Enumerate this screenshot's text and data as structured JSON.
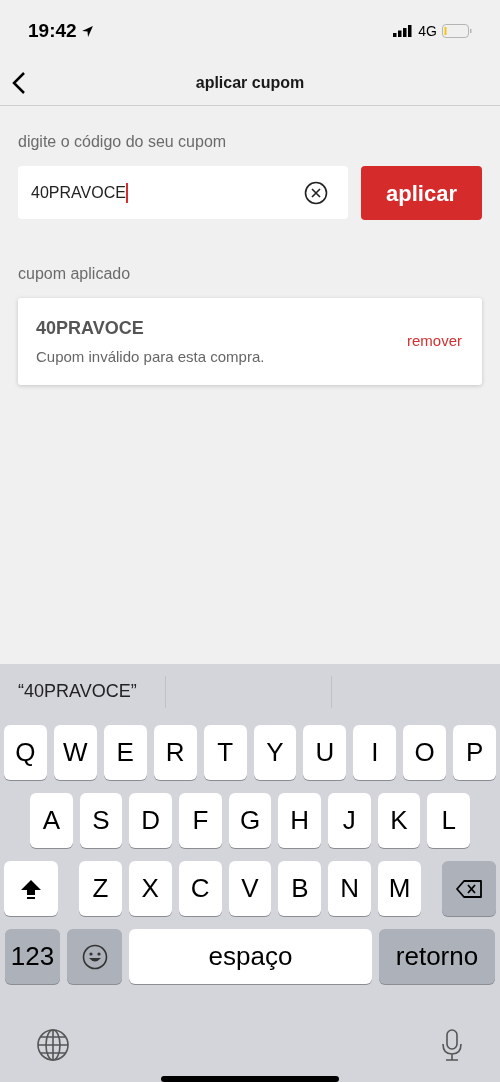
{
  "status_bar": {
    "time": "19:42",
    "network": "4G"
  },
  "nav": {
    "title": "aplicar cupom"
  },
  "coupon_form": {
    "label": "digite o código do seu cupom",
    "value": "40PRAVOCE",
    "button": "aplicar"
  },
  "applied": {
    "label": "cupom aplicado",
    "code": "40PRAVOCE",
    "message": "Cupom inválido para esta compra.",
    "action": "remover"
  },
  "keyboard": {
    "suggestions": [
      "“40PRAVOCE”"
    ],
    "letter_rows": [
      [
        "Q",
        "W",
        "E",
        "R",
        "T",
        "Y",
        "U",
        "I",
        "O",
        "P"
      ],
      [
        "A",
        "S",
        "D",
        "F",
        "G",
        "H",
        "J",
        "K",
        "L"
      ],
      [
        "Z",
        "X",
        "C",
        "V",
        "B",
        "N",
        "M"
      ]
    ],
    "numbers_key": "123",
    "space_key": "espaço",
    "return_key": "retorno"
  }
}
